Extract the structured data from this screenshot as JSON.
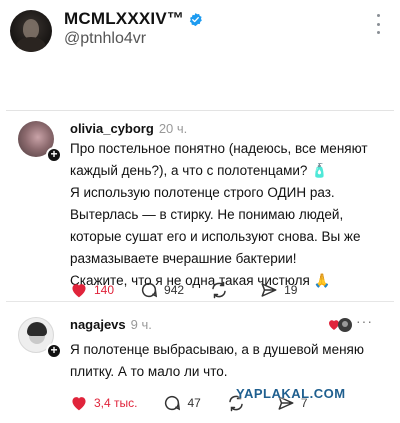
{
  "tweet": {
    "display_name": "MCMLXXXIV™",
    "handle": "@ptnhlo4vr"
  },
  "post1": {
    "username": "olivia_cyborg",
    "time": "20 ч.",
    "lines": [
      "Про постельное понятно (надеюсь, все меняют",
      "каждый день?), а что с полотенцами? 🧴",
      "Я использую полотенце строго ОДИН раз.",
      "Вытерлась — в стирку. Не понимаю людей,",
      "которые сушат его и используют снова. Вы же",
      "размазываете вчерашние бактерии!",
      "Скажите, что я не одна такая чистюля 🙏"
    ],
    "likes": "140",
    "comments": "942",
    "shares": "19"
  },
  "post2": {
    "username": "nagajevs",
    "time": "9 ч.",
    "more": "···",
    "lines": [
      "Я полотенце выбрасываю, а в душевой меняю",
      "плитку. А то мало ли что."
    ],
    "likes": "3,4 тыс.",
    "comments": "47",
    "shares": "7"
  },
  "watermark": "YAPLAKAL.COM",
  "colors": {
    "like_red": "#e0243b",
    "verified_blue": "#1d9bf0"
  }
}
